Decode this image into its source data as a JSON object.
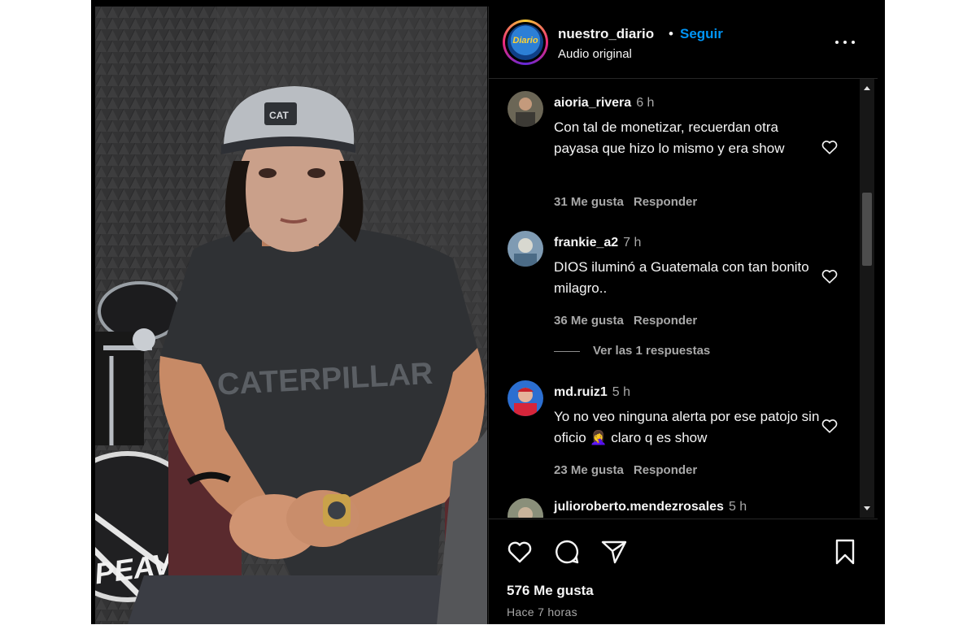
{
  "post": {
    "owner_username": "nuestro_diario",
    "separator": "•",
    "follow_label": "Seguir",
    "audio_label": "Audio original",
    "avatar_text": "Diario",
    "likes_label": "576 Me gusta",
    "posted_ago": "Hace 7 horas"
  },
  "media": {
    "cap_logo_text": "CAT",
    "shirt_text": "CATERPILLAR",
    "drum_text": "PEAVEY"
  },
  "comments": [
    {
      "username": "aioria_rivera",
      "time": "6 h",
      "text": "Con tal de monetizar, recuerdan otra payasa que hizo lo mismo y era show",
      "likes": "31 Me gusta",
      "reply_label": "Responder"
    },
    {
      "username": "frankie_a2",
      "time": "7 h",
      "text": "DIOS iluminó a Guatemala con tan bonito milagro..",
      "likes": "36 Me gusta",
      "reply_label": "Responder",
      "view_replies": "Ver las 1 respuestas"
    },
    {
      "username": "md.ruiz1",
      "time": "5 h",
      "text": "Yo no veo ninguna alerta por ese patojo sin oficio 🤦‍♀️ claro q es show",
      "likes": "23 Me gusta",
      "reply_label": "Responder"
    },
    {
      "username": "julioroberto.mendezrosales",
      "time": "5 h"
    }
  ],
  "icons": {
    "more": "more-icon",
    "like": "heart-icon",
    "comment": "comment-icon",
    "share": "send-icon",
    "save": "bookmark-icon"
  },
  "colors": {
    "accent": "#0095f6",
    "panel_bg": "#000000",
    "text": "#f5f5f5",
    "muted": "#a8a8a8"
  }
}
